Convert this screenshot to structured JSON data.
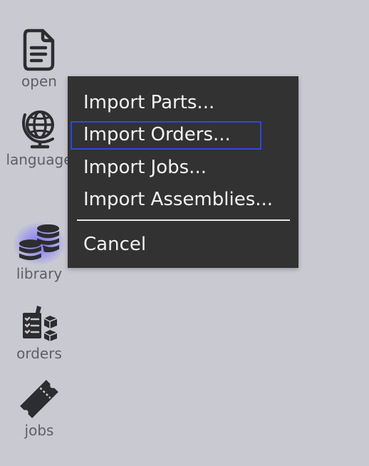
{
  "sidebar": {
    "items": [
      {
        "label": "open",
        "icon": "document-icon"
      },
      {
        "label": "language",
        "icon": "globe-icon"
      },
      {
        "label": "library",
        "icon": "coins-stack-icon",
        "active": true
      },
      {
        "label": "orders",
        "icon": "checklist-boxes-icon"
      },
      {
        "label": "jobs",
        "icon": "ticket-icon"
      }
    ]
  },
  "context_menu": {
    "items": [
      {
        "label": "Import Parts..."
      },
      {
        "label": "Import Orders...",
        "focused": true
      },
      {
        "label": "Import Jobs..."
      },
      {
        "label": "Import Assemblies..."
      }
    ],
    "cancel_label": "Cancel"
  },
  "colors": {
    "background": "#c9c9d2",
    "menu_background": "#323232",
    "menu_text": "#f2f2f2",
    "focus_ring": "#2b47e8",
    "icon": "#2d2d30",
    "sidebar_label": "#5e5e63",
    "active_glow": "#6e64ff"
  }
}
